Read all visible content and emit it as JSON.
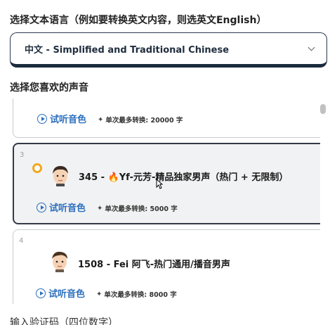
{
  "language": {
    "label": "选择文本语言（例如要转换英文内容，则选英文English）",
    "selected": "中文 - Simplified and Traditional Chinese"
  },
  "voice": {
    "label": "选择您喜欢的声音",
    "cards": [
      {
        "index": "",
        "name": "",
        "listen_label": "试听音色",
        "max_conversion": "单次最多转换: 20000 字",
        "selected": false
      },
      {
        "index": "3",
        "name": "345 - 🔥Yf-元芳-精品独家男声（热门 + 无限制）",
        "listen_label": "试听音色",
        "max_conversion": "单次最多转换: 5000 字",
        "selected": true
      },
      {
        "index": "4",
        "name": "1508 - Fei 阿飞-热门通用/播音男声",
        "listen_label": "试听音色",
        "max_conversion": "单次最多转换: 8000 字",
        "selected": false
      }
    ]
  },
  "captcha": {
    "label": "输入验证码（四位数字）"
  },
  "colors": {
    "accent_blue": "#2c6fbd",
    "radio_orange": "#f2a81d",
    "select_border": "#1c2b3d"
  }
}
